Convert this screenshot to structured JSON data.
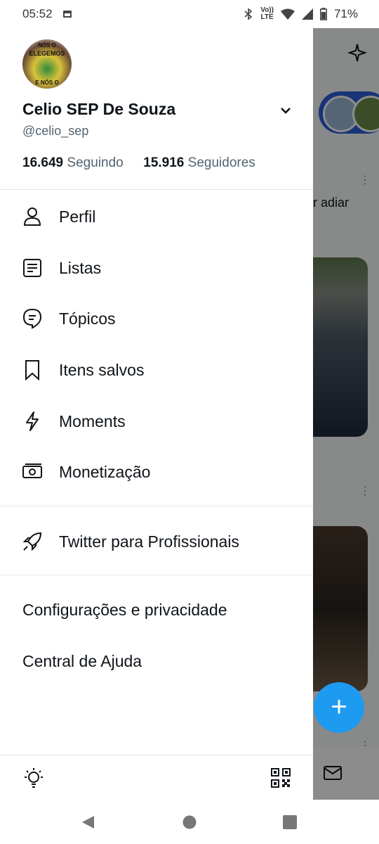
{
  "status_bar": {
    "time": "05:52",
    "network_top": "Vo))",
    "network_bottom": "LTE",
    "battery": "71%"
  },
  "profile": {
    "avatar_text": [
      "NÓS O",
      "ELEGEMOS",
      "E NÓS O"
    ],
    "name": "Celio SEP De Souza",
    "handle": "@celio_sep",
    "following_count": "16.649",
    "following_label": "Seguindo",
    "followers_count": "15.916",
    "followers_label": "Seguidores"
  },
  "menu": {
    "items": [
      {
        "label": "Perfil",
        "icon": "person-icon"
      },
      {
        "label": "Listas",
        "icon": "list-icon"
      },
      {
        "label": "Tópicos",
        "icon": "topics-icon"
      },
      {
        "label": "Itens salvos",
        "icon": "bookmark-icon"
      },
      {
        "label": "Moments",
        "icon": "lightning-icon"
      },
      {
        "label": "Monetização",
        "icon": "money-icon"
      }
    ],
    "professional": {
      "label": "Twitter para Profissionais",
      "icon": "rocket-icon"
    },
    "settings_label": "Configurações e privacidade",
    "help_label": "Central de Ajuda"
  },
  "background": {
    "partial_text": "r adiar"
  },
  "colors": {
    "accent": "#1d9bf0",
    "secondary_text": "#536471"
  }
}
